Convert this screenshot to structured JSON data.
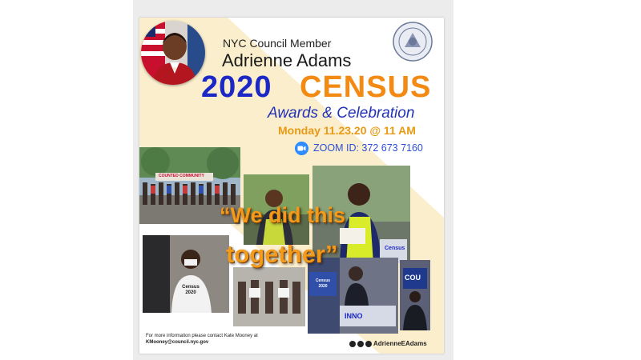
{
  "flyer": {
    "role": "NYC Council Member",
    "name": "Adrienne Adams",
    "year": "2020",
    "census": "CENSUS",
    "subtitle": "Awards & Celebration",
    "date": "Monday 11.23.20 @ 11 AM",
    "zoom": "ZOOM ID: 372 673 7160",
    "quote_line1": "“We did this",
    "quote_line2": "together”",
    "contact_line": "For more information please contact Kate Mooney at",
    "contact_email": "KMooney@council.nyc.gov",
    "social_handle": "AdrienneEAdams"
  },
  "photo_text": {
    "banner": "COUNTED COMMUNITY",
    "census_shirt": "Census 2020",
    "bag": "Census",
    "sign1": "Census 2020",
    "sign2": "COU",
    "sign3": "INNO"
  },
  "colors": {
    "blue": "#1b28c6",
    "orange": "#f28a14",
    "cream": "#fbeecd",
    "zoom_blue": "#2d8cff"
  },
  "icons": [
    "nyc-seal-icon",
    "zoom-icon",
    "facebook-icon",
    "twitter-icon",
    "instagram-icon"
  ]
}
